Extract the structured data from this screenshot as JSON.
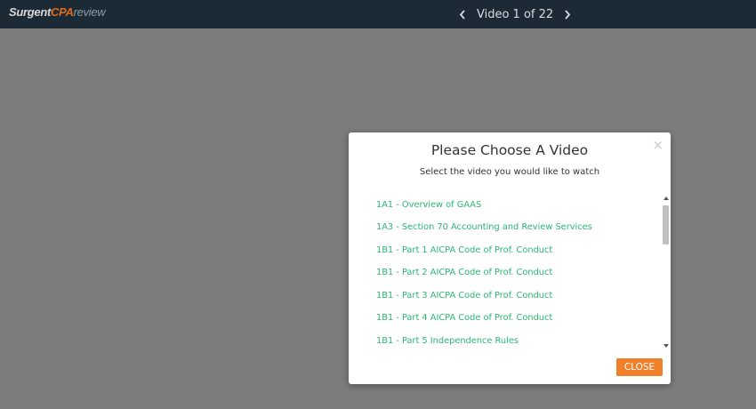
{
  "header": {
    "logo": {
      "part1": "Surgent",
      "part2": "CPA",
      "part3": "review"
    },
    "prev_icon": "chevron-left-icon",
    "next_icon": "chevron-right-icon",
    "video_counter": "Video 1 of 22"
  },
  "modal": {
    "title": "Please Choose A Video",
    "subtitle": "Select the video you would like to watch",
    "close_symbol": "×",
    "close_button_label": "CLOSE",
    "videos": [
      "1A1 - Overview of GAAS",
      "1A3 - Section 70 Accounting and Review Services",
      "1B1 - Part 1 AICPA Code of Prof. Conduct",
      "1B1 - Part 2 AICPA Code of Prof. Conduct",
      "1B1 - Part 3 AICPA Code of Prof. Conduct",
      "1B1 - Part 4 AICPA Code of Prof. Conduct",
      "1B1 - Part 5 Independence Rules"
    ]
  },
  "colors": {
    "topbar": "#1c2a35",
    "overlay": "#7c7c7c",
    "link_green": "#2bb673",
    "accent_orange": "#f0802a"
  }
}
